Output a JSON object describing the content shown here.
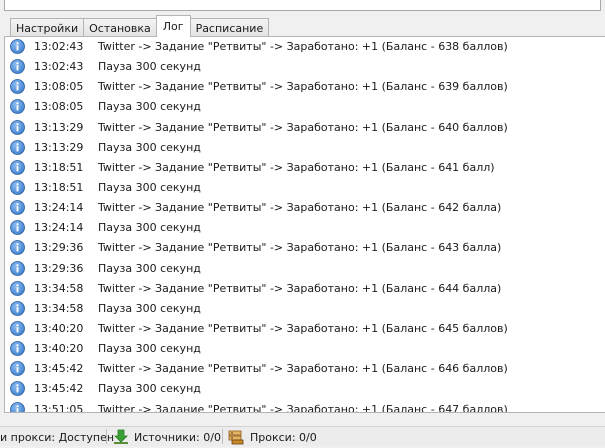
{
  "tabs": [
    {
      "label": "Настройки",
      "active": false
    },
    {
      "label": "Остановка",
      "active": false
    },
    {
      "label": "Лог",
      "active": true
    },
    {
      "label": "Расписание",
      "active": false
    }
  ],
  "log": {
    "entries": [
      {
        "icon": "info-icon",
        "time": "13:02:43",
        "message": "Twitter -> Задание \"Ретвиты\" -> Заработано: +1 (Баланс - 638 баллов)"
      },
      {
        "icon": "info-icon",
        "time": "13:02:43",
        "message": "Пауза 300 секунд"
      },
      {
        "icon": "info-icon",
        "time": "13:08:05",
        "message": "Twitter -> Задание \"Ретвиты\" -> Заработано: +1 (Баланс - 639 баллов)"
      },
      {
        "icon": "info-icon",
        "time": "13:08:05",
        "message": "Пауза 300 секунд"
      },
      {
        "icon": "info-icon",
        "time": "13:13:29",
        "message": "Twitter -> Задание \"Ретвиты\" -> Заработано: +1 (Баланс - 640 баллов)"
      },
      {
        "icon": "info-icon",
        "time": "13:13:29",
        "message": "Пауза 300 секунд"
      },
      {
        "icon": "info-icon",
        "time": "13:18:51",
        "message": "Twitter -> Задание \"Ретвиты\" -> Заработано: +1 (Баланс - 641 балл)"
      },
      {
        "icon": "info-icon",
        "time": "13:18:51",
        "message": "Пауза 300 секунд"
      },
      {
        "icon": "info-icon",
        "time": "13:24:14",
        "message": "Twitter -> Задание \"Ретвиты\" -> Заработано: +1 (Баланс - 642 балла)"
      },
      {
        "icon": "info-icon",
        "time": "13:24:14",
        "message": "Пауза 300 секунд"
      },
      {
        "icon": "info-icon",
        "time": "13:29:36",
        "message": "Twitter -> Задание \"Ретвиты\" -> Заработано: +1 (Баланс - 643 балла)"
      },
      {
        "icon": "info-icon",
        "time": "13:29:36",
        "message": "Пауза 300 секунд"
      },
      {
        "icon": "info-icon",
        "time": "13:34:58",
        "message": "Twitter -> Задание \"Ретвиты\" -> Заработано: +1 (Баланс - 644 балла)"
      },
      {
        "icon": "info-icon",
        "time": "13:34:58",
        "message": "Пауза 300 секунд"
      },
      {
        "icon": "info-icon",
        "time": "13:40:20",
        "message": "Twitter -> Задание \"Ретвиты\" -> Заработано: +1 (Баланс - 645 баллов)"
      },
      {
        "icon": "info-icon",
        "time": "13:40:20",
        "message": "Пауза 300 секунд"
      },
      {
        "icon": "info-icon",
        "time": "13:45:42",
        "message": "Twitter -> Задание \"Ретвиты\" -> Заработано: +1 (Баланс - 646 баллов)"
      },
      {
        "icon": "info-icon",
        "time": "13:45:42",
        "message": "Пауза 300 секунд"
      },
      {
        "icon": "info-icon",
        "time": "13:51:05",
        "message": "Twitter -> Задание \"Ретвиты\" -> Заработано: +1 (Баланс - 647 баллов)"
      }
    ]
  },
  "status_bar": {
    "proxy_check_text": "и прокси: Доступен",
    "sources_text": "Источники: 0/0",
    "proxies_text": "Прокси: 0/0",
    "icons": {
      "sources": "download-arrow-icon",
      "proxies": "server-icon"
    },
    "colors": {
      "sources_icon": "#3aa034",
      "proxies_icon": "#c98a2a"
    }
  },
  "colors": {
    "info_icon": "#3c7fd0",
    "panel_bg": "#ffffff",
    "window_bg": "#f0f0f0"
  }
}
